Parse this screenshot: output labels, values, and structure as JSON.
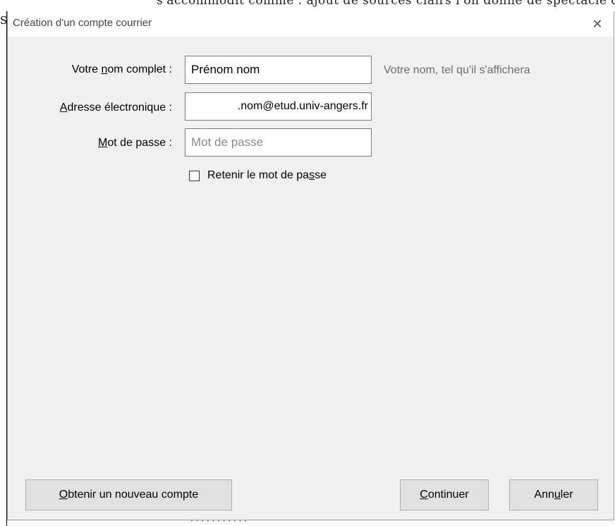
{
  "dialog": {
    "title": "Création d'un compte courrier",
    "close_symbol": "✕"
  },
  "form": {
    "name": {
      "label_before": "Votre ",
      "label_accel": "n",
      "label_after": "om complet :",
      "value": "Prénom nom",
      "hint": "Votre nom, tel qu'il s'affichera"
    },
    "email": {
      "label_before": "",
      "label_accel": "A",
      "label_after": "dresse électronique :",
      "value": ".nom@etud.univ-angers.fr"
    },
    "password": {
      "label_before": "",
      "label_accel": "M",
      "label_after": "ot de passe :",
      "value": "",
      "placeholder": "Mot de passe"
    },
    "remember": {
      "label_before": "Retenir le mot de pa",
      "label_accel": "s",
      "label_after": "se",
      "checked": false
    }
  },
  "buttons": {
    "new_account": {
      "label_before": "",
      "label_accel": "O",
      "label_after": "btenir un nouveau compte"
    },
    "continue": {
      "label_before": "",
      "label_accel": "C",
      "label_after": "ontinuer"
    },
    "cancel": {
      "label_before": "Ann",
      "label_accel": "u",
      "label_after": "ler"
    }
  },
  "icons": {
    "close": "close-icon",
    "checkbox": "checkbox-unchecked-icon"
  }
}
